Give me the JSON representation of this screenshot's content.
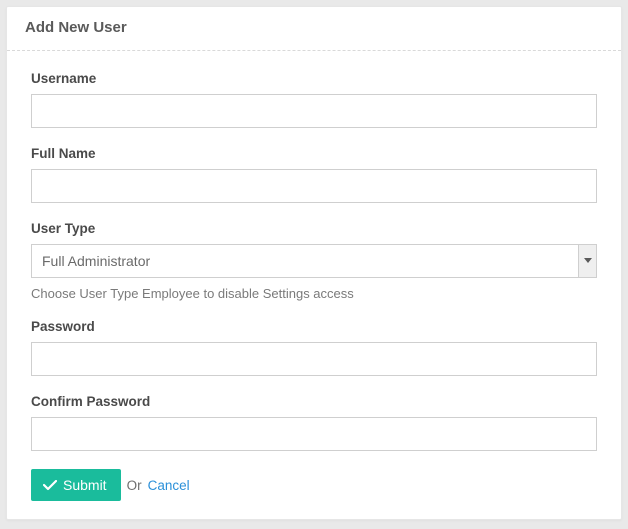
{
  "header": {
    "title": "Add New User"
  },
  "form": {
    "username": {
      "label": "Username",
      "value": ""
    },
    "fullname": {
      "label": "Full Name",
      "value": ""
    },
    "usertype": {
      "label": "User Type",
      "selected": "Full Administrator",
      "help": "Choose User Type Employee to disable Settings access"
    },
    "password": {
      "label": "Password",
      "value": ""
    },
    "confirm_password": {
      "label": "Confirm Password",
      "value": ""
    }
  },
  "actions": {
    "submit_label": "Submit",
    "or_text": "Or",
    "cancel_label": "Cancel"
  }
}
